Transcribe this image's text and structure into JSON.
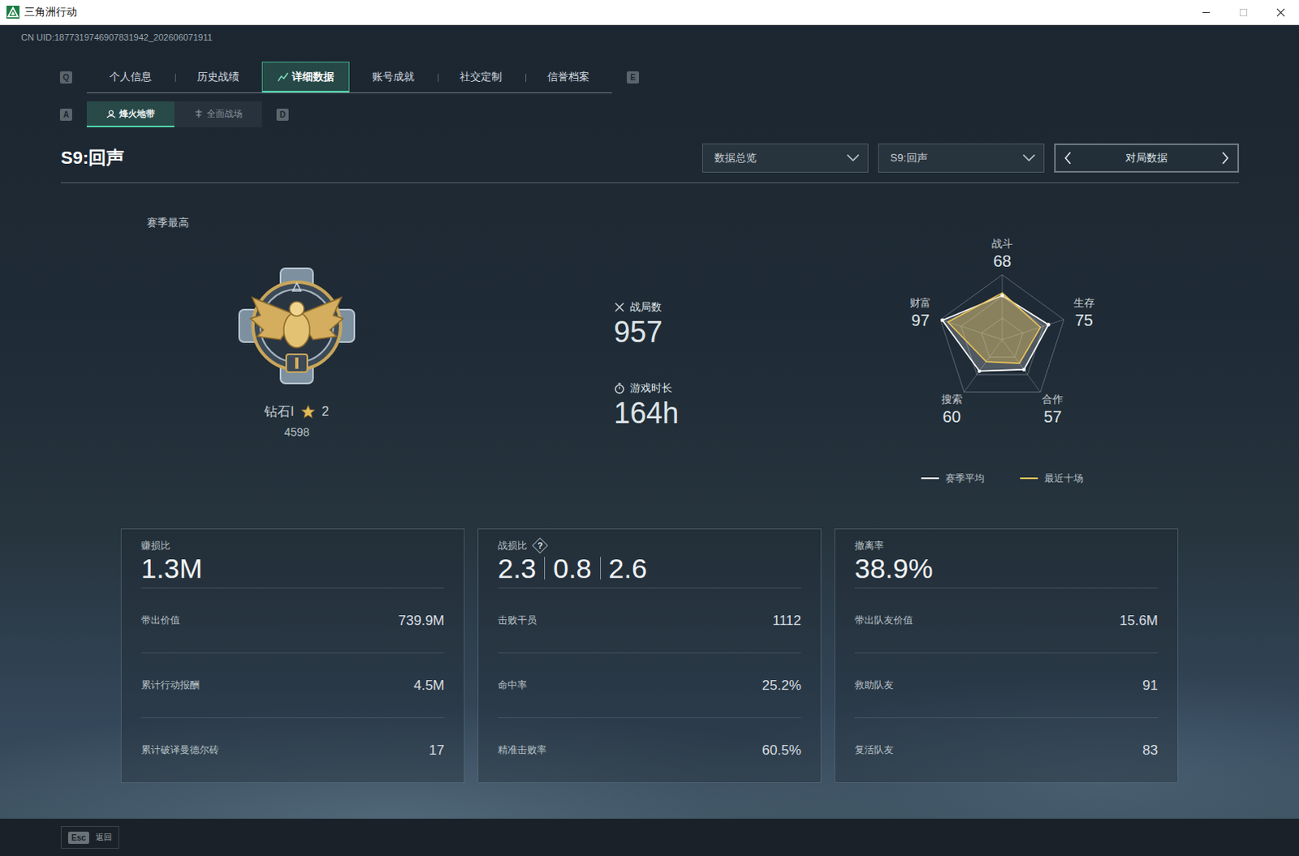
{
  "window": {
    "title": "三角洲行动"
  },
  "uid": "CN UID:1877319746907831942_202606071911",
  "tabs": {
    "prev_key": "Q",
    "next_key": "E",
    "items": [
      {
        "label": "个人信息",
        "selected": false
      },
      {
        "label": "历史战绩",
        "selected": false
      },
      {
        "label": "详细数据",
        "selected": true
      },
      {
        "label": "账号成就",
        "selected": false
      },
      {
        "label": "社交定制",
        "selected": false
      },
      {
        "label": "信誉档案",
        "selected": false
      }
    ]
  },
  "mode_tabs": {
    "prev_key": "A",
    "next_key": "D",
    "items": [
      {
        "label": "烽火地带",
        "kind": "extraction",
        "selected": true
      },
      {
        "label": "全面战场",
        "kind": "warfare",
        "selected": false
      }
    ]
  },
  "header": {
    "title": "S9:回声",
    "dropdowns": [
      "数据总览",
      "S9:回声"
    ],
    "pager": "对局数据"
  },
  "season_best": {
    "label": "赛季最高",
    "rank": "钻石I",
    "star_count": "2",
    "score": "4598"
  },
  "stats": [
    {
      "kind": "battles",
      "label": "战局数",
      "value": "957"
    },
    {
      "kind": "time",
      "label": "游戏时长",
      "value": "164h"
    }
  ],
  "radar": {
    "axes": [
      {
        "label": "战斗",
        "value": "68"
      },
      {
        "label": "生存",
        "value": "75"
      },
      {
        "label": "合作",
        "value": "57"
      },
      {
        "label": "搜索",
        "value": "60"
      },
      {
        "label": "财富",
        "value": "97"
      }
    ],
    "series": [
      {
        "name": "赛季平均",
        "color": "#ffffff",
        "values": [
          68,
          75,
          57,
          60,
          97
        ]
      },
      {
        "name": "最近十场",
        "color": "#e8c35a",
        "values": [
          72,
          62,
          45,
          42,
          88
        ]
      }
    ]
  },
  "cards": [
    {
      "label": "赚损比",
      "help": "",
      "values": [
        "1.3M"
      ],
      "rows": [
        {
          "label": "带出价值",
          "value": "739.9M"
        },
        {
          "label": "累计行动报酬",
          "value": "4.5M"
        },
        {
          "label": "累计破译曼德尔砖",
          "value": "17"
        }
      ]
    },
    {
      "label": "战损比",
      "help": "?",
      "values": [
        "2.3",
        "0.8",
        "2.6"
      ],
      "rows": [
        {
          "label": "击败干员",
          "value": "1112"
        },
        {
          "label": "命中率",
          "value": "25.2%"
        },
        {
          "label": "精准击败率",
          "value": "60.5%"
        }
      ]
    },
    {
      "label": "撤离率",
      "help": "",
      "values": [
        "38.9%"
      ],
      "rows": [
        {
          "label": "带出队友价值",
          "value": "15.6M"
        },
        {
          "label": "救助队友",
          "value": "91"
        },
        {
          "label": "复活队友",
          "value": "83"
        }
      ]
    }
  ],
  "footer": {
    "key": "Esc",
    "label": "返回"
  }
}
